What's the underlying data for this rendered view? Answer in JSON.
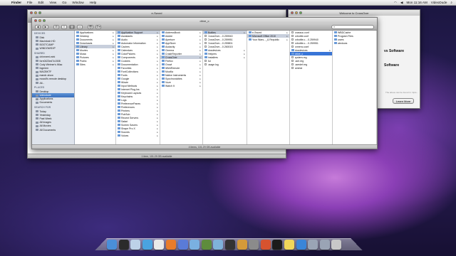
{
  "menubar": {
    "app": "Finder",
    "items": [
      "File",
      "Edit",
      "View",
      "Go",
      "Window",
      "Help"
    ],
    "clock": "Mon 11:16 AM",
    "user": "VideoDude"
  },
  "back_window": {
    "title": "e-Sword",
    "status": "1 item, 101.29 GB available"
  },
  "crossover_window": {
    "title": "Welcome to CrossOver",
    "heading1": "vs Software",
    "heading2": "Software",
    "note": "The above can be found in: Opts...",
    "button": "Learn More"
  },
  "front_window": {
    "title": "drive_c",
    "search_placeholder": "",
    "status": "4 items, 101.29 GB available",
    "toolbar": {
      "back": "◀",
      "forward": "▶",
      "view_icon": "⊞",
      "view_list": "≡",
      "view_col": "▥",
      "view_cover": "▭",
      "quicklook": "👁",
      "action": "⚙▾"
    }
  },
  "sidebar": {
    "devices_label": "DEVICES",
    "devices": [
      "Disk",
      "Macintosh HD",
      "BOOTCAMP",
      "WINDOWSXP"
    ],
    "shared_label": "SHARED",
    "shared": [
      "chinmeet-mini",
      "forn0423ed7c1508",
      "Cody Weimer's iMac",
      "fogmem",
      "MACBKTF",
      "mandr-show",
      "mossfi's remote desktop",
      "All..."
    ],
    "places_label": "PLACES",
    "places": [
      "Desktop",
      "videodude",
      "Applications",
      "Documents"
    ],
    "search_label": "SEARCH FOR",
    "search": [
      "Today",
      "Yesterday",
      "Past Week",
      "All Images",
      "All Movies",
      "All Documents"
    ]
  },
  "columns": {
    "col1": [
      "Applications",
      "Desktop",
      "Documents",
      "Downloads",
      "Library",
      "Movies",
      "Music",
      "Pictures",
      "Public",
      "Sites"
    ],
    "col2": [
      "Application Support",
      "Assistants",
      "Audio",
      "Automator Information",
      "Caches",
      "Calendars",
      "ColorPickers",
      "Components",
      "Cookies",
      "Documentation",
      "Favorites",
      "FontCollections",
      "Fonts",
      "Google",
      "iMovie",
      "Input Methods",
      "Internet Plug-Ins",
      "Keyboard Layouts",
      "Keychains",
      "Logs",
      "PreferencePanes",
      "Preferences",
      "Printers",
      "PubSub",
      "Recent Servers",
      "Safari",
      "Screen Savers",
      "Shape Pro X",
      "Sounds",
      "Voices"
    ],
    "col3": [
      "AddressBook",
      "Adobe",
      "Aperture",
      "AppStore",
      "Audacity",
      "Cinema",
      "CrashReporter",
      "CrossOver",
      "Firefox",
      "Growl",
      "iWebRemote",
      "Mozilla",
      "Native Instruments",
      "Synchronicities",
      "Vuze",
      "Watch It"
    ],
    "col4": [
      "Bottles",
      "CrossOver....0.259940",
      "CrossOver....0.259951",
      "CrossOver....0.259801",
      "CrossOver....0.260015",
      "dosdevices",
      "Helpers",
      "installers",
      "Jul",
      "usage.log"
    ],
    "col5": [
      "e-Sword",
      "Microsoft Office 2010",
      "Your Wars..._& Republic"
    ],
    "col6": [
      "cxassoc.conf",
      "cxbottle.conf",
      "cxbottle.c....0.259940",
      "cxbottle.c....0.259951",
      "cxmenu.conf",
      "dosdevices",
      "drive_c",
      "system.reg",
      "user.reg",
      "userdef.reg",
      "wininst"
    ],
    "col7": [
      "WBDCache",
      "Program Files",
      "users",
      "windows"
    ]
  },
  "dock": {
    "icons": [
      "finder-icon",
      "dashboard-icon",
      "mail-icon",
      "safari-icon",
      "ical-icon",
      "firefox-icon",
      "itunes-icon",
      "preview-icon",
      "photo-icon",
      "iphoto-icon",
      "imovie-icon",
      "garageband-icon",
      "system-prefs-icon",
      "crossover-icon",
      "terminal-icon",
      "stickies-icon",
      "app-store-icon",
      "documents-stack-icon",
      "downloads-stack-icon",
      "trash-icon"
    ],
    "colors": [
      "#4a8fd9",
      "#2b2b2b",
      "#bdd2e8",
      "#4aa3e0",
      "#e9e9e9",
      "#e97c2b",
      "#5a7bd8",
      "#7ab0e0",
      "#5e8c3c",
      "#7fb2d9",
      "#333",
      "#d59a3a",
      "#8b8b8b",
      "#d6532f",
      "#1b1b1b",
      "#efd65a",
      "#3a85d8",
      "#9aa4b5",
      "#9aa4b5",
      "#c8c8c8"
    ]
  }
}
